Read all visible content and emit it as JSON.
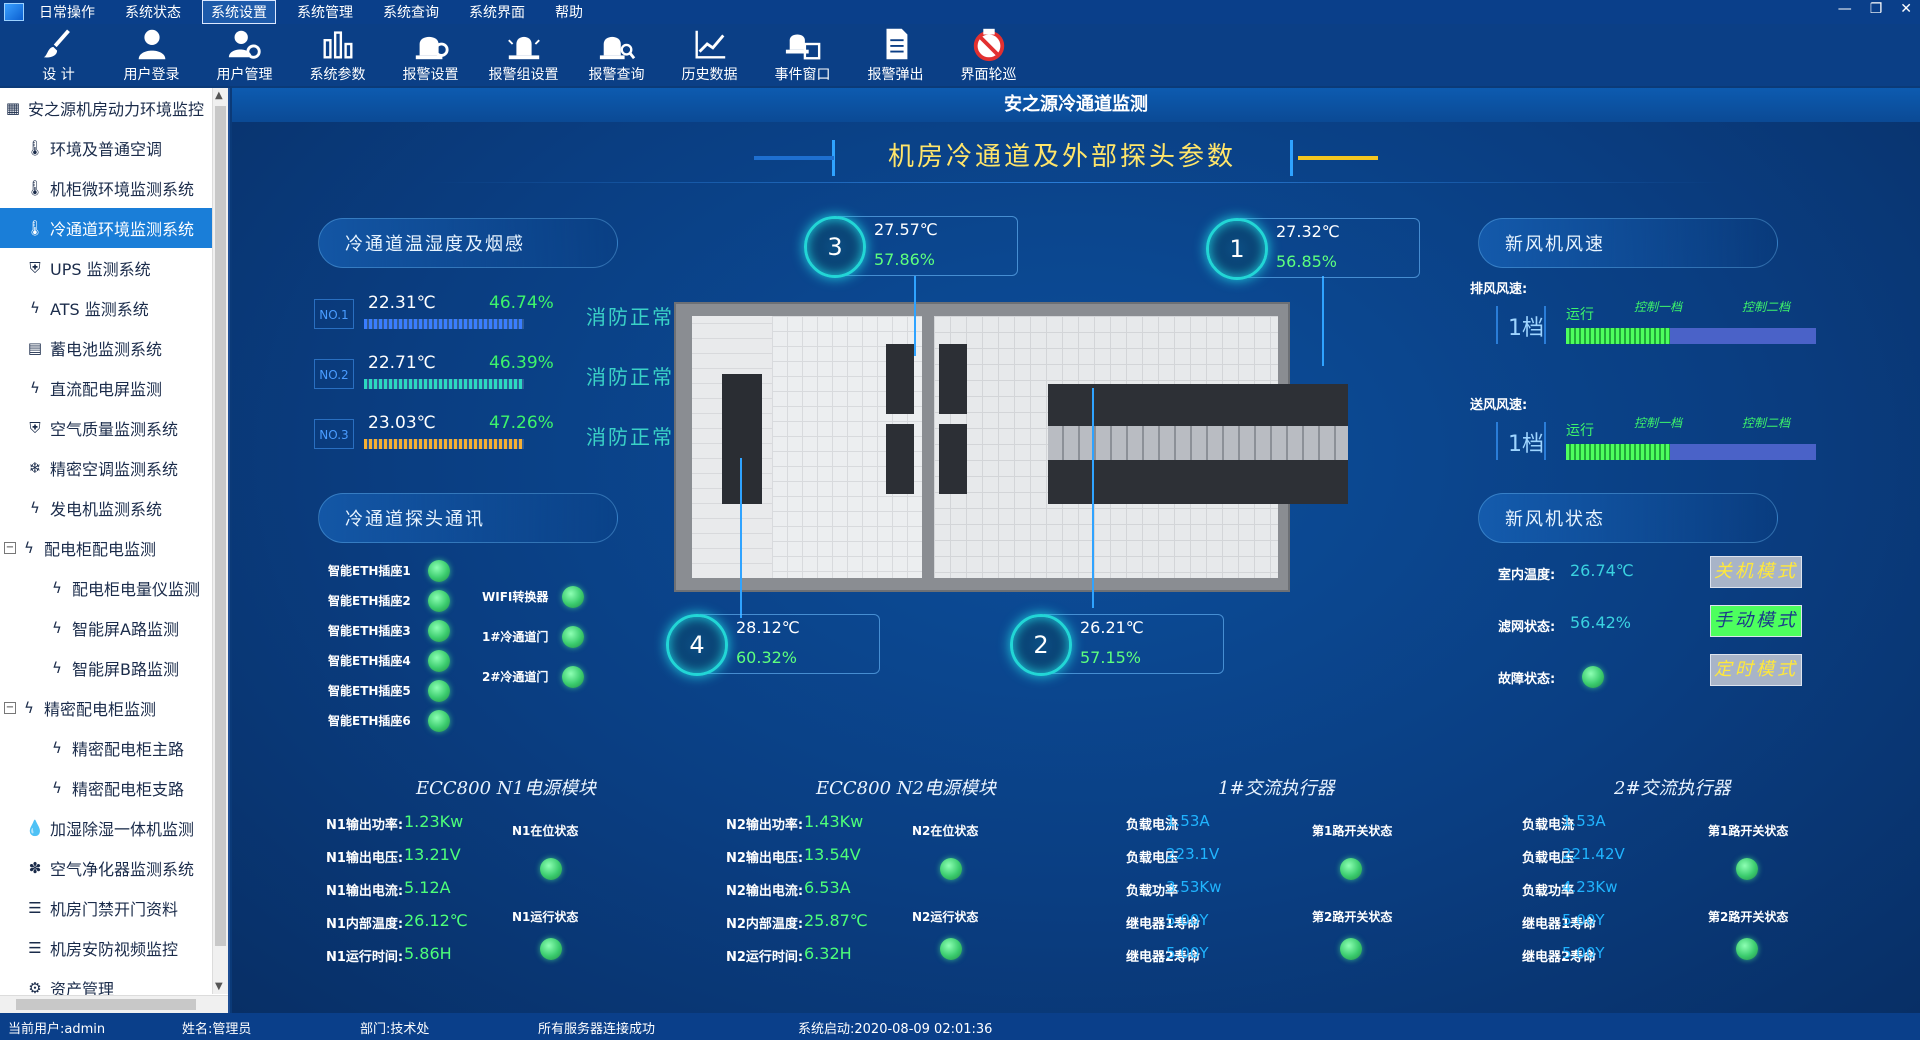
{
  "menu": {
    "items": [
      "日常操作",
      "系统状态",
      "系统设置",
      "系统管理",
      "系统查询",
      "系统界面",
      "帮助"
    ],
    "active_index": 2,
    "window_controls": [
      "—",
      "❐",
      "✕"
    ]
  },
  "toolbar": {
    "buttons": [
      {
        "label": "设  计",
        "icon": "brush-icon"
      },
      {
        "label": "用户登录",
        "icon": "user-icon"
      },
      {
        "label": "用户管理",
        "icon": "user-gear-icon"
      },
      {
        "label": "系统参数",
        "icon": "bars-icon"
      },
      {
        "label": "报警设置",
        "icon": "alarm-gear-icon"
      },
      {
        "label": "报警组设置",
        "icon": "alarm-group-icon"
      },
      {
        "label": "报警查询",
        "icon": "alarm-search-icon"
      },
      {
        "label": "历史数据",
        "icon": "line-chart-icon"
      },
      {
        "label": "事件窗口",
        "icon": "event-window-icon"
      },
      {
        "label": "报警弹出",
        "icon": "document-icon"
      },
      {
        "label": "界面轮巡",
        "icon": "no-entry-icon"
      }
    ]
  },
  "sidebar": {
    "items": [
      {
        "label": "安之源机房动力环境监控",
        "indent": 0,
        "icon": "grid-icon",
        "expander": ""
      },
      {
        "label": "环境及普通空调",
        "indent": 1,
        "icon": "thermometer-icon",
        "expander": ""
      },
      {
        "label": "机柜微环境监测系统",
        "indent": 1,
        "icon": "thermometer-icon",
        "expander": ""
      },
      {
        "label": "冷通道环境监测系统",
        "indent": 1,
        "icon": "thermometer-icon",
        "expander": "",
        "active": true
      },
      {
        "label": "UPS 监测系统",
        "indent": 1,
        "icon": "shield-icon",
        "expander": ""
      },
      {
        "label": "ATS 监测系统",
        "indent": 1,
        "icon": "bolt-icon",
        "expander": ""
      },
      {
        "label": "蓄电池监测系统",
        "indent": 1,
        "icon": "battery-icon",
        "expander": ""
      },
      {
        "label": "直流配电屏监测",
        "indent": 1,
        "icon": "bolt-icon",
        "expander": ""
      },
      {
        "label": "空气质量监测系统",
        "indent": 1,
        "icon": "shield-icon",
        "expander": ""
      },
      {
        "label": "精密空调监测系统",
        "indent": 1,
        "icon": "snowflake-icon",
        "expander": ""
      },
      {
        "label": "发电机监测系统",
        "indent": 1,
        "icon": "bolt-icon",
        "expander": ""
      },
      {
        "label": "配电柜配电监测",
        "indent": 0,
        "icon": "bolt-icon",
        "expander": "−"
      },
      {
        "label": "配电柜电量仪监测",
        "indent": 2,
        "icon": "bolt-icon",
        "expander": ""
      },
      {
        "label": "智能屏A路监测",
        "indent": 2,
        "icon": "bolt-icon",
        "expander": ""
      },
      {
        "label": "智能屏B路监测",
        "indent": 2,
        "icon": "bolt-icon",
        "expander": ""
      },
      {
        "label": "精密配电柜监测",
        "indent": 0,
        "icon": "bolt-icon",
        "expander": "−"
      },
      {
        "label": "精密配电柜主路",
        "indent": 2,
        "icon": "bolt-icon",
        "expander": ""
      },
      {
        "label": "精密配电柜支路",
        "indent": 2,
        "icon": "bolt-icon",
        "expander": ""
      },
      {
        "label": "加湿除湿一体机监测",
        "indent": 1,
        "icon": "droplet-icon",
        "expander": ""
      },
      {
        "label": "空气净化器监测系统",
        "indent": 1,
        "icon": "fan-icon",
        "expander": ""
      },
      {
        "label": "机房门禁开门资料",
        "indent": 1,
        "icon": "list-icon",
        "expander": ""
      },
      {
        "label": "机房安防视频监控",
        "indent": 1,
        "icon": "list-icon",
        "expander": ""
      },
      {
        "label": "资产管理",
        "indent": 1,
        "icon": "gear-icon",
        "expander": ""
      }
    ]
  },
  "main": {
    "window_title": "安之源冷通道监测",
    "banner_title": "机房冷通道及外部探头参数",
    "section_humidity_title": "冷通道温湿度及烟感",
    "section_comm_title": "冷通道探头通讯",
    "section_fan_speed_title": "新风机风速",
    "section_fan_status_title": "新风机状态",
    "humidity_rows": [
      {
        "no": "NO.1",
        "temp": "22.31℃",
        "hum": "46.74%",
        "fire": "消防正常",
        "bar_color": "#3a7dff"
      },
      {
        "no": "NO.2",
        "temp": "22.71℃",
        "hum": "46.39%",
        "fire": "消防正常",
        "bar_color": "#2bd9c0"
      },
      {
        "no": "NO.3",
        "temp": "23.03℃",
        "hum": "47.26%",
        "fire": "消防正常",
        "bar_color": "#f5b034"
      }
    ],
    "comm_left": [
      "智能ETH插座1",
      "智能ETH插座2",
      "智能ETH插座3",
      "智能ETH插座4",
      "智能ETH插座5",
      "智能ETH插座6"
    ],
    "comm_right": [
      "WIFI转换器",
      "1#冷通道门",
      "2#冷通道门"
    ],
    "probes": [
      {
        "num": "3",
        "temp": "27.57℃",
        "hum": "57.86%"
      },
      {
        "num": "1",
        "temp": "27.32℃",
        "hum": "56.85%"
      },
      {
        "num": "4",
        "temp": "28.12℃",
        "hum": "60.32%"
      },
      {
        "num": "2",
        "temp": "26.21℃",
        "hum": "57.15%"
      }
    ],
    "fan_speed": {
      "exhaust_label": "排风风速:",
      "supply_label": "送风风速:",
      "exhaust_gear": "1档",
      "supply_gear": "1档",
      "run_text": "运行",
      "ctrl1": "控制一档",
      "ctrl2": "控制二档"
    },
    "fan_status": {
      "indoor_temp_label": "室内温度:",
      "indoor_temp": "26.74℃",
      "filter_label": "滤网状态:",
      "filter_value": "56.42%",
      "fault_label": "故障状态:",
      "modes": [
        "关机模式",
        "手动模式",
        "定时模式"
      ],
      "active_mode_index": 1
    },
    "ecc_n1": {
      "title": "ECC800  N1电源模块",
      "rows": [
        {
          "label": "N1输出功率:",
          "value": "1.23Kw"
        },
        {
          "label": "N1输出电压:",
          "value": "13.21V"
        },
        {
          "label": "N1输出电流:",
          "value": "5.12A"
        },
        {
          "label": "N1内部温度:",
          "value": "26.12℃"
        },
        {
          "label": "N1运行时间:",
          "value": "5.86H"
        }
      ],
      "status_online": "N1在位状态",
      "status_running": "N1运行状态"
    },
    "ecc_n2": {
      "title": "ECC800  N2电源模块",
      "rows": [
        {
          "label": "N2输出功率:",
          "value": "1.43Kw"
        },
        {
          "label": "N2输出电压:",
          "value": "13.54V"
        },
        {
          "label": "N2输出电流:",
          "value": "6.53A"
        },
        {
          "label": "N2内部温度:",
          "value": "25.87℃"
        },
        {
          "label": "N2运行时间:",
          "value": "6.32H"
        }
      ],
      "status_online": "N2在位状态",
      "status_running": "N2运行状态"
    },
    "ac1": {
      "title": "1#交流执行器",
      "rows": [
        {
          "label": "负载电流",
          "value": "1.53A"
        },
        {
          "label": "负载电压",
          "value": "223.1V"
        },
        {
          "label": "负载功率",
          "value": "3.53Kw"
        },
        {
          "label": "继电器1寿命",
          "value": "5.00Y"
        },
        {
          "label": "继电器2寿命",
          "value": "5.00Y"
        }
      ],
      "switch1": "第1路开关状态",
      "switch2": "第2路开关状态"
    },
    "ac2": {
      "title": "2#交流执行器",
      "rows": [
        {
          "label": "负载电流",
          "value": "1.53A"
        },
        {
          "label": "负载电压",
          "value": "221.42V"
        },
        {
          "label": "负载功率",
          "value": "4.23Kw"
        },
        {
          "label": "继电器1寿命",
          "value": "5.00Y"
        },
        {
          "label": "继电器2寿命",
          "value": "5.00Y"
        }
      ],
      "switch1": "第1路开关状态",
      "switch2": "第2路开关状态"
    }
  },
  "statusbar": {
    "user": "当前用户:admin",
    "name": "姓名:管理员",
    "dept": "部门:技术处",
    "server": "所有服务器连接成功",
    "start": "系统启动:2020-08-09 02:01:36"
  }
}
